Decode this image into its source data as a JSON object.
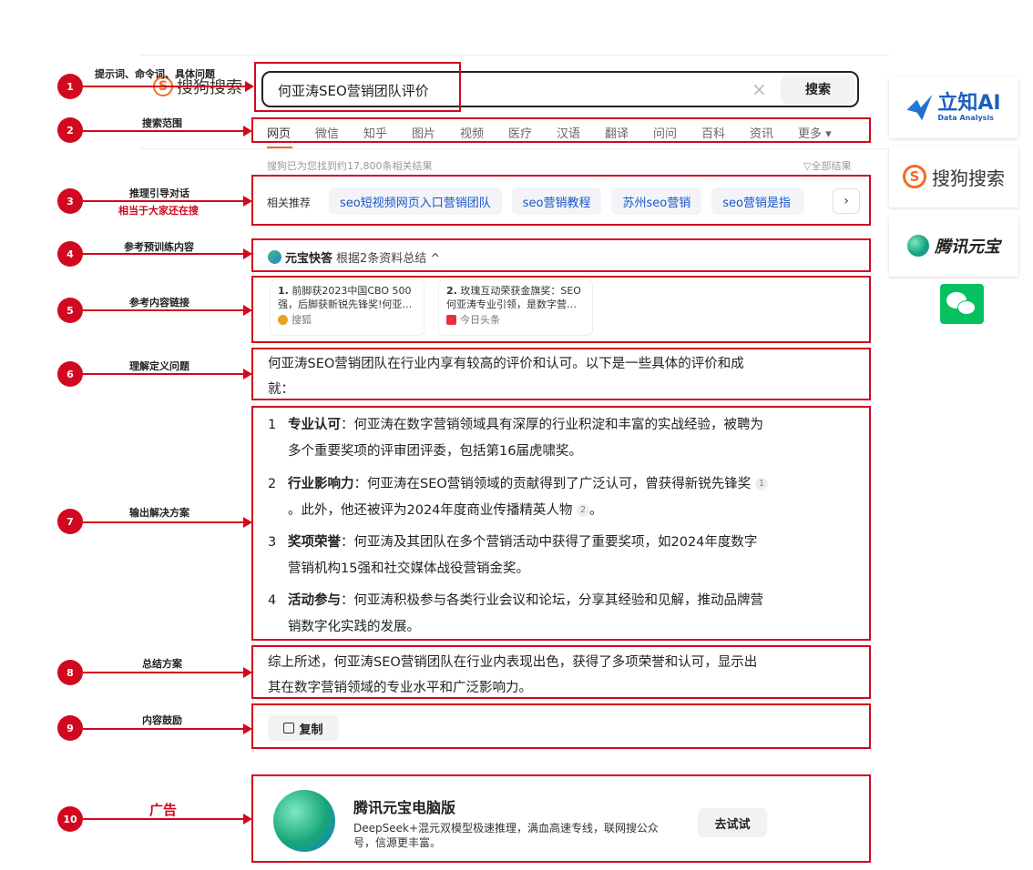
{
  "search": {
    "logo_text": "搜狗搜索",
    "logo_mark": "S",
    "query": "何亚涛SEO营销团队评价",
    "button": "搜索",
    "clear_icon": "×"
  },
  "tabs": [
    "网页",
    "微信",
    "知乎",
    "图片",
    "视频",
    "医疗",
    "汉语",
    "翻译",
    "问问",
    "百科",
    "资讯",
    "更多 ▾"
  ],
  "result_count": "搜狗已为您找到约17,800条相关结果",
  "all_results": "▽全部结果",
  "related": {
    "label": "相关推荐",
    "chips": [
      "seo短视频网页入口营销团队",
      "seo营销教程",
      "苏州seo营销",
      "seo营销是指"
    ],
    "next": "›"
  },
  "yuanbao": {
    "title": "元宝快答",
    "subtitle": "根据2条资料总结 ^"
  },
  "refs": [
    {
      "num": "1.",
      "text": "前脚获2023中国CBO 500强，后脚获新锐先锋奖!何亚…",
      "source": "搜狐",
      "color": "#e7a328"
    },
    {
      "num": "2.",
      "text": "玫瑰互动荣获金旗奖：SEO何亚涛专业引领，是数字营…",
      "source": "今日头条",
      "color": "#e8313e"
    }
  ],
  "intro": "何亚涛SEO营销团队在行业内享有较高的评价和认可。以下是一些具体的评价和成就：",
  "items": [
    {
      "num": "1",
      "title": "专业认可",
      "text": "：何亚涛在数字营销领域具有深厚的行业积淀和丰富的实战经验，被聘为多个重要奖项的评审团评委，包括第16届虎啸奖。"
    },
    {
      "num": "2",
      "title": "行业影响力",
      "text_a": "：何亚涛在SEO营销领域的贡献得到了广泛认可，曾获得新锐先锋奖",
      "cite_a": "1",
      "text_b": "。此外，他还被评为2024年度商业传播精英人物",
      "cite_b": "2",
      "text_c": "。"
    },
    {
      "num": "3",
      "title": "奖项荣誉",
      "text": "：何亚涛及其团队在多个营销活动中获得了重要奖项，如2024年度数字营销机构15强和社交媒体战役营销金奖。"
    },
    {
      "num": "4",
      "title": "活动参与",
      "text": "：何亚涛积极参与各类行业会议和论坛，分享其经验和见解，推动品牌营销数字化实践的发展。"
    }
  ],
  "summary": "综上所述，何亚涛SEO营销团队在行业内表现出色，获得了多项荣誉和认可，显示出其在数字营销领域的专业水平和广泛影响力。",
  "copy": "复制",
  "ad": {
    "title": "腾讯元宝电脑版",
    "desc": "DeepSeek+混元双模型极速推理，满血高速专线，联网搜公众号，信源更丰富。",
    "button": "去试试"
  },
  "annotations": [
    {
      "num": "1",
      "label": "提示词、命令词、具体问题"
    },
    {
      "num": "2",
      "label": "搜索范围"
    },
    {
      "num": "3",
      "label": "推理引导对话",
      "sub": "相当于大家还在搜"
    },
    {
      "num": "4",
      "label": "参考预训练内容"
    },
    {
      "num": "5",
      "label": "参考内容链接"
    },
    {
      "num": "6",
      "label": "理解定义问题"
    },
    {
      "num": "7",
      "label": "输出解决方案"
    },
    {
      "num": "8",
      "label": "总结方案"
    },
    {
      "num": "9",
      "label": "内容鼓励"
    },
    {
      "num": "10",
      "label": "广告"
    }
  ],
  "sidebar": {
    "lizhi": {
      "main": "立知AI",
      "sub": "Data Analysis"
    },
    "sogou": "搜狗搜索",
    "yuanbao": "腾讯元宝",
    "wechat_icon": "wechat-icon"
  },
  "colors": {
    "annotation_red": "#d2091e",
    "sogou_orange": "#f26b21",
    "link_blue": "#1a55c9",
    "wechat_green": "#07c160"
  }
}
